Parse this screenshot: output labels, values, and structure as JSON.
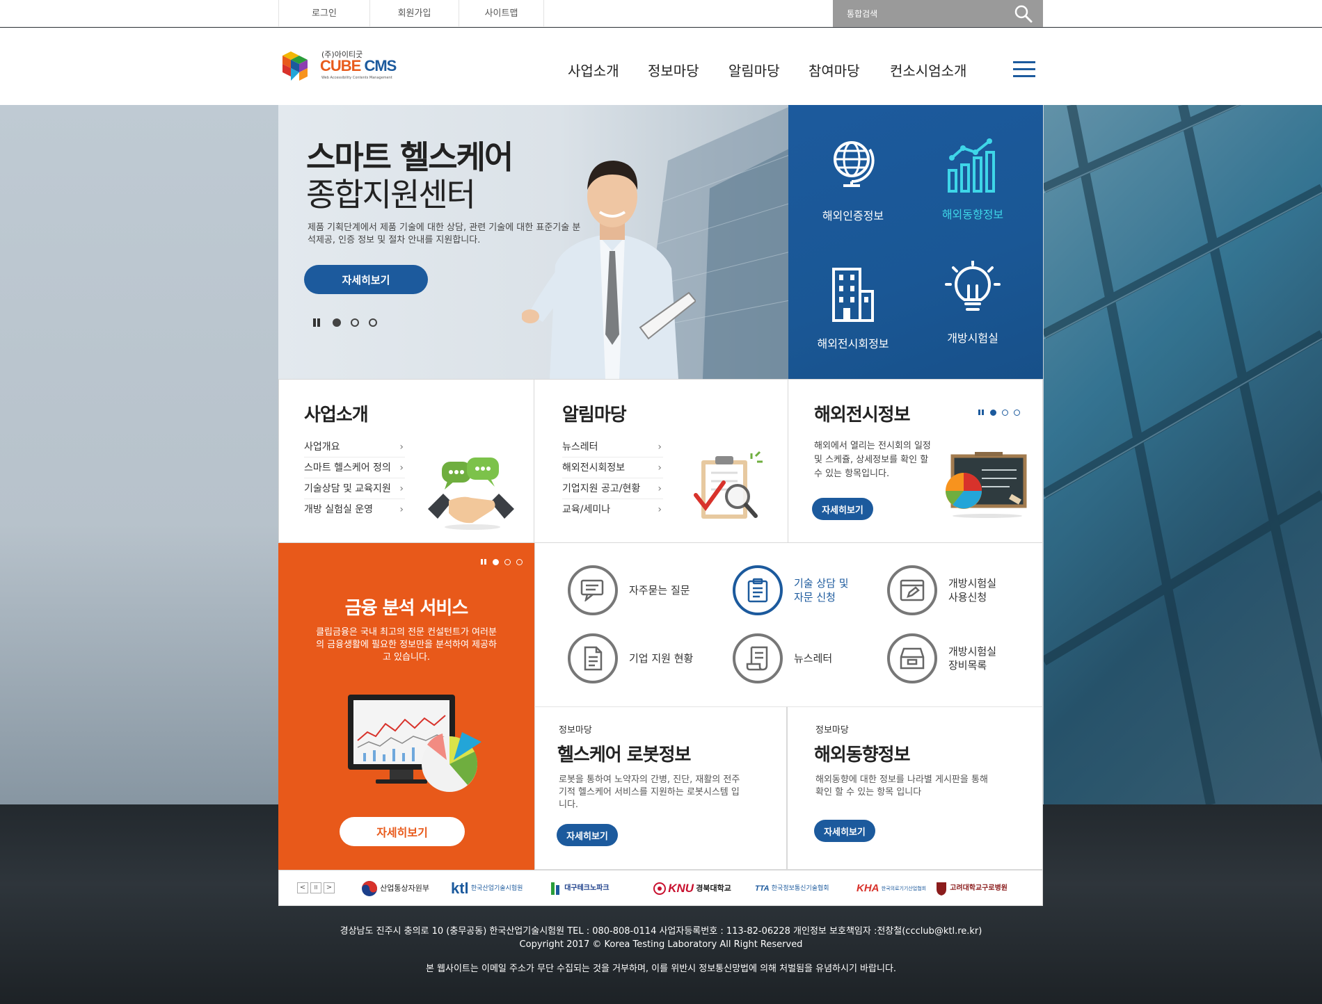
{
  "utility": {
    "login": "로그인",
    "join": "회원가입",
    "sitemap": "사이트맵",
    "search_placeholder": "통합검색"
  },
  "logo": {
    "corp": "(주)아이티굿",
    "brand_a": "CUBE",
    "brand_b": " CMS",
    "sub": "Web Accessibility Contents Management"
  },
  "nav": [
    "사업소개",
    "정보마당",
    "알림마당",
    "참여마당",
    "컨소시엄소개"
  ],
  "hero": {
    "title_line1": "스마트 헬스케어",
    "title_line2": "종합지원센터",
    "desc": "제품 기획단계에서 제품 기술에 대한 상담, 관련 기술에 대한 표준기술 분석제공, 인증 정보 및 절차 안내를 지원합니다.",
    "button": "자세히보기"
  },
  "quick": [
    "해외인증정보",
    "해외동향정보",
    "해외전시회정보",
    "개방시험실"
  ],
  "card_business": {
    "title": "사업소개",
    "items": [
      "사업개요",
      "스마트 헬스케어 정의",
      "기술상담 및 교육지원",
      "개방 실험실 운영"
    ],
    "arrow": "›"
  },
  "card_notice": {
    "title": "알림마당",
    "items": [
      "뉴스레터",
      "해외전시회정보",
      "기업지원 공고/현황",
      "교육/세미나"
    ],
    "arrow": "›"
  },
  "card_exhibit": {
    "title": "해외전시정보",
    "desc": "해외에서 열리는 전시회의 일정 및 스케쥴, 상세정보를 확인 할 수 있는 항목입니다.",
    "button": "자세히보기"
  },
  "orange": {
    "title": "금융 분석 서비스",
    "desc": "클립금융은 국내 최고의 전문 컨설턴트가 여러분의 금융생활에 필요한 정보만을 분석하여 제공하고 있습니다.",
    "button": "자세히보기"
  },
  "icon_menu": {
    "faq": "자주묻는 질문",
    "consult_l1": "기술 상담 및",
    "consult_l2": "자문 신청",
    "lab_use_l1": "개방시험실",
    "lab_use_l2": "사용신청",
    "support": "기업 지원 현황",
    "newsletter": "뉴스레터",
    "lab_equip_l1": "개방시험실",
    "lab_equip_l2": "장비목록"
  },
  "info_robot": {
    "category": "정보마당",
    "title": "헬스케어 로봇정보",
    "desc": "로봇을 통하여 노약자의 간병, 진단, 재활의 전주기적 헬스케어 서비스를 지원하는 로봇시스템 입니다.",
    "button": "자세히보기"
  },
  "info_trend": {
    "category": "정보마당",
    "title": "해외동향정보",
    "desc": "해외동향에 대한 정보를 나라별 게시판을 통해 확인 할 수 있는 항목 입니다",
    "button": "자세히보기"
  },
  "partners": {
    "prev": "<",
    "pause": "II",
    "next": ">",
    "motie": "산업통상자원부",
    "ktl_mark": "ktl",
    "ktl_name": "한국산업기술시험원",
    "dtp": "대구테크노파크",
    "knu_mark": "KNU",
    "knu_name": "경북대학교",
    "tta_mark": "TTA",
    "tta_name": "한국정보통신기술협회",
    "kha_mark": "KHA",
    "kha_name": "한국의료기기산업협회",
    "kumc": "고려대학교구로병원"
  },
  "footer": {
    "address": "경상남도 진주시 충의로 10 (충무공동) 한국산업기술시험원 TEL : 080-808-0114 사업자등록번호 : 113-82-06228 개인정보 보호책임자 :전창철(ccclub@ktl.re.kr)",
    "copyright": "Copyright 2017 © Korea Testing Laboratory All Right Reserved",
    "notice": "본 웹사이트는 이메일 주소가 무단 수집되는 것을 거부하며, 이를 위반시 정보통신망법에 의해 처벌됨을 유념하시기 바랍니다."
  },
  "colors": {
    "primary": "#1c5a9d",
    "accent": "#e8591a",
    "footer_bg": "#23292e"
  }
}
